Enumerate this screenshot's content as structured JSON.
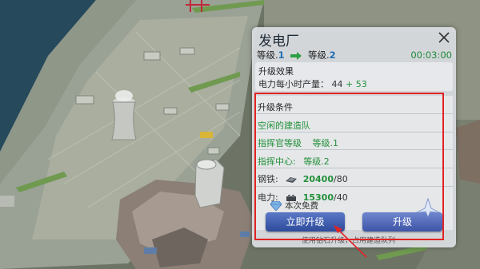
{
  "panel": {
    "title": "发电厂",
    "level_from_label": "等级.",
    "level_from_value": "1",
    "level_to_label": "等级.",
    "level_to_value": "2",
    "timer": "00:03:00"
  },
  "effect": {
    "heading": "升级效果",
    "label": "电力每小时产量：",
    "base": "44",
    "plus": "+",
    "bonus": "53"
  },
  "conditions": {
    "heading": "升级条件",
    "builder": "空闲的建造队",
    "commander_label": "指挥官等级",
    "commander_level_label": "等级.",
    "commander_level_value": "1",
    "center_label": "指挥中心:",
    "center_level_label": "等级.",
    "center_level_value": "2",
    "steel_label": "钢铁:",
    "steel_have": "20400",
    "steel_need": "/80",
    "power_label": "电力:",
    "power_have": "15300",
    "power_need": "/40"
  },
  "actions": {
    "free_note": "本次免费",
    "upgrade_now": "立即升级",
    "upgrade": "升级",
    "hint": "使用钻石升级，占用建造队列"
  },
  "colors": {
    "accent_blue": "#2d4b9a",
    "green": "#23903a",
    "highlight_red": "#e02424"
  },
  "icons": [
    "close-icon",
    "arrow-right-icon",
    "steel-icon",
    "power-icon",
    "diamond-icon",
    "wing-emblem-icon"
  ]
}
